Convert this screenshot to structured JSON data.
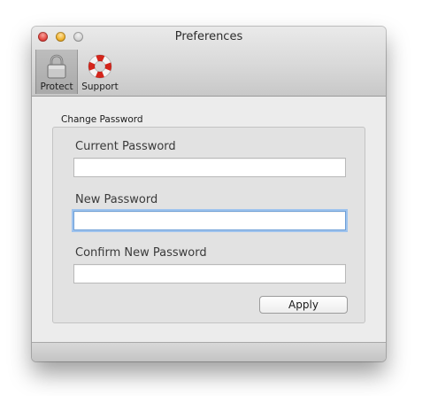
{
  "window": {
    "title": "Preferences"
  },
  "toolbar": {
    "items": [
      {
        "label": "Protect",
        "icon": "padlock-icon",
        "selected": true
      },
      {
        "label": "Support",
        "icon": "lifebuoy-icon",
        "selected": false
      }
    ]
  },
  "change_password": {
    "group_label": "Change Password",
    "current_password": {
      "label": "Current Password",
      "value": ""
    },
    "new_password": {
      "label": "New Password",
      "value": "",
      "focused": true
    },
    "confirm_password": {
      "label": "Confirm New Password",
      "value": ""
    },
    "apply_label": "Apply"
  },
  "colors": {
    "close": "#e4453f",
    "minimize": "#f0b12c",
    "zoom": "#cfcfcf",
    "focus_ring": "#9ec3ee",
    "lifebuoy_red": "#d4261c"
  }
}
